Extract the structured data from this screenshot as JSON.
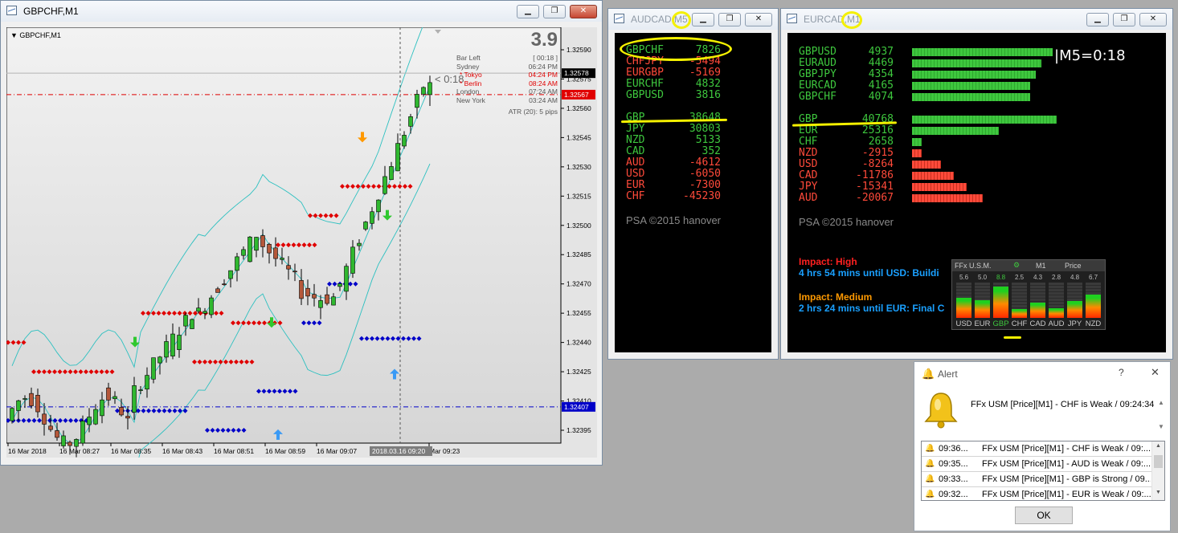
{
  "window_chart": {
    "title": "GBPCHF,M1",
    "inner_label": "GBPCHF,M1",
    "spread": "3.9",
    "countdown": "< 0:18",
    "info_lines": [
      {
        "label": "Bar Left",
        "value": "[ 00:18 ]",
        "color": "#555555"
      },
      {
        "label": "Sydney",
        "value": "06:24 PM",
        "color": "#555555"
      },
      {
        "label": "* Tokyo",
        "value": "04:24 PM",
        "color": "#e00000"
      },
      {
        "label": "* Berlin",
        "value": "08:24 AM",
        "color": "#e00000"
      },
      {
        "label": "London",
        "value": "07:24 AM",
        "color": "#555555"
      },
      {
        "label": "New York",
        "value": "03:24 AM",
        "color": "#555555"
      }
    ],
    "atr": "ATR (20): 5 pips",
    "price_ticks": [
      "1.32590",
      "1.32575",
      "1.32560",
      "1.32545",
      "1.32530",
      "1.32515",
      "1.32500",
      "1.32485",
      "1.32470",
      "1.32455",
      "1.32440",
      "1.32425",
      "1.32410",
      "1.32395"
    ],
    "price_labels": {
      "bid": "1.32578",
      "red_line": "1.32567",
      "blue_line": "1.32407"
    },
    "time_ticks": [
      "16 Mar 2018",
      "16 Mar 08:27",
      "16 Mar 08:35",
      "16 Mar 08:43",
      "16 Mar 08:51",
      "16 Mar 08:59",
      "16 Mar 09:07",
      "Mar 09:23"
    ],
    "cursor_time": "2018.03.16 09:20"
  },
  "window_audcad": {
    "title_pair": "AUDCAD,",
    "title_tf": "M5",
    "pair_rows": [
      {
        "name": "GBPCHF",
        "value": "7826",
        "color": "#3ec73e"
      },
      {
        "name": "CHFJPY",
        "value": "-5494",
        "color": "#ff4a3a"
      },
      {
        "name": "EURGBP",
        "value": "-5169",
        "color": "#ff4a3a"
      },
      {
        "name": "EURCHF",
        "value": "4832",
        "color": "#3ec73e"
      },
      {
        "name": "GBPUSD",
        "value": "3816",
        "color": "#3ec73e"
      }
    ],
    "currency_rows": [
      {
        "name": "GBP",
        "value": "38648",
        "color": "#3ec73e"
      },
      {
        "name": "JPY",
        "value": "30803",
        "color": "#3ec73e"
      },
      {
        "name": "NZD",
        "value": "5133",
        "color": "#3ec73e"
      },
      {
        "name": "CAD",
        "value": "352",
        "color": "#3ec73e"
      },
      {
        "name": "AUD",
        "value": "-4612",
        "color": "#ff4a3a"
      },
      {
        "name": "USD",
        "value": "-6050",
        "color": "#ff4a3a"
      },
      {
        "name": "EUR",
        "value": "-7300",
        "color": "#ff4a3a"
      },
      {
        "name": "CHF",
        "value": "-45230",
        "color": "#ff4a3a"
      }
    ],
    "footer": "PSA ©2015 hanover"
  },
  "window_eurcad": {
    "title_pair": "EURCAD,",
    "title_tf": "M1",
    "timer": "M5=0:18",
    "pair_rows": [
      {
        "name": "GBPUSD",
        "value": "4937",
        "bar": 0.25
      },
      {
        "name": "EURAUD",
        "value": "4469",
        "bar": 0.23
      },
      {
        "name": "GBPJPY",
        "value": "4354",
        "bar": 0.22
      },
      {
        "name": "EURCAD",
        "value": "4165",
        "bar": 0.21
      },
      {
        "name": "GBPCHF",
        "value": "4074",
        "bar": 0.21
      }
    ],
    "currency_rows": [
      {
        "name": "GBP",
        "value": "40768",
        "color": "#3ec73e",
        "bar": 0.45
      },
      {
        "name": "EUR",
        "value": "25316",
        "color": "#3ec73e",
        "bar": 0.27
      },
      {
        "name": "CHF",
        "value": "2658",
        "color": "#3ec73e",
        "bar": 0.03
      },
      {
        "name": "NZD",
        "value": "-2915",
        "color": "#ff4a3a",
        "bar": 0.03
      },
      {
        "name": "USD",
        "value": "-8264",
        "color": "#ff4a3a",
        "bar": 0.09
      },
      {
        "name": "CAD",
        "value": "-11786",
        "color": "#ff4a3a",
        "bar": 0.13
      },
      {
        "name": "JPY",
        "value": "-15341",
        "color": "#ff4a3a",
        "bar": 0.17
      },
      {
        "name": "AUD",
        "value": "-20067",
        "color": "#ff4a3a",
        "bar": 0.22
      }
    ],
    "footer": "PSA ©2015 hanover",
    "news": [
      {
        "impact": "Impact: High",
        "impact_color": "#ff2020",
        "text": "4 hrs 54 mins until USD: Buildi"
      },
      {
        "impact": "Impact: Medium",
        "impact_color": "#ff9900",
        "text": "2 hrs 24 mins until EUR: Final C"
      }
    ],
    "meter": {
      "header": [
        "FFx U.S.M.",
        "M1",
        "Price"
      ],
      "currencies": [
        "USD",
        "EUR",
        "GBP",
        "CHF",
        "CAD",
        "AUD",
        "JPY",
        "NZD"
      ],
      "scores": [
        "5.6",
        "5.0",
        "8.8",
        "2.5",
        "4.3",
        "2.8",
        "4.8",
        "6.7"
      ],
      "levels": [
        0.56,
        0.5,
        0.88,
        0.25,
        0.43,
        0.28,
        0.48,
        0.67
      ]
    }
  },
  "alert": {
    "title": "Alert",
    "help": "?",
    "close": "✕",
    "message": "FFx USM [Price][M1] - CHF is Weak / 09:24:34",
    "rows": [
      {
        "time": "09:36...",
        "text": "FFx USM [Price][M1] - CHF is Weak / 09:..."
      },
      {
        "time": "09:35...",
        "text": "FFx USM [Price][M1] - AUD is Weak / 09:..."
      },
      {
        "time": "09:33...",
        "text": "FFx USM [Price][M1] - GBP is Strong / 09..."
      },
      {
        "time": "09:32...",
        "text": "FFx USM [Price][M1] - EUR is Weak / 09:..."
      }
    ],
    "ok": "OK"
  }
}
